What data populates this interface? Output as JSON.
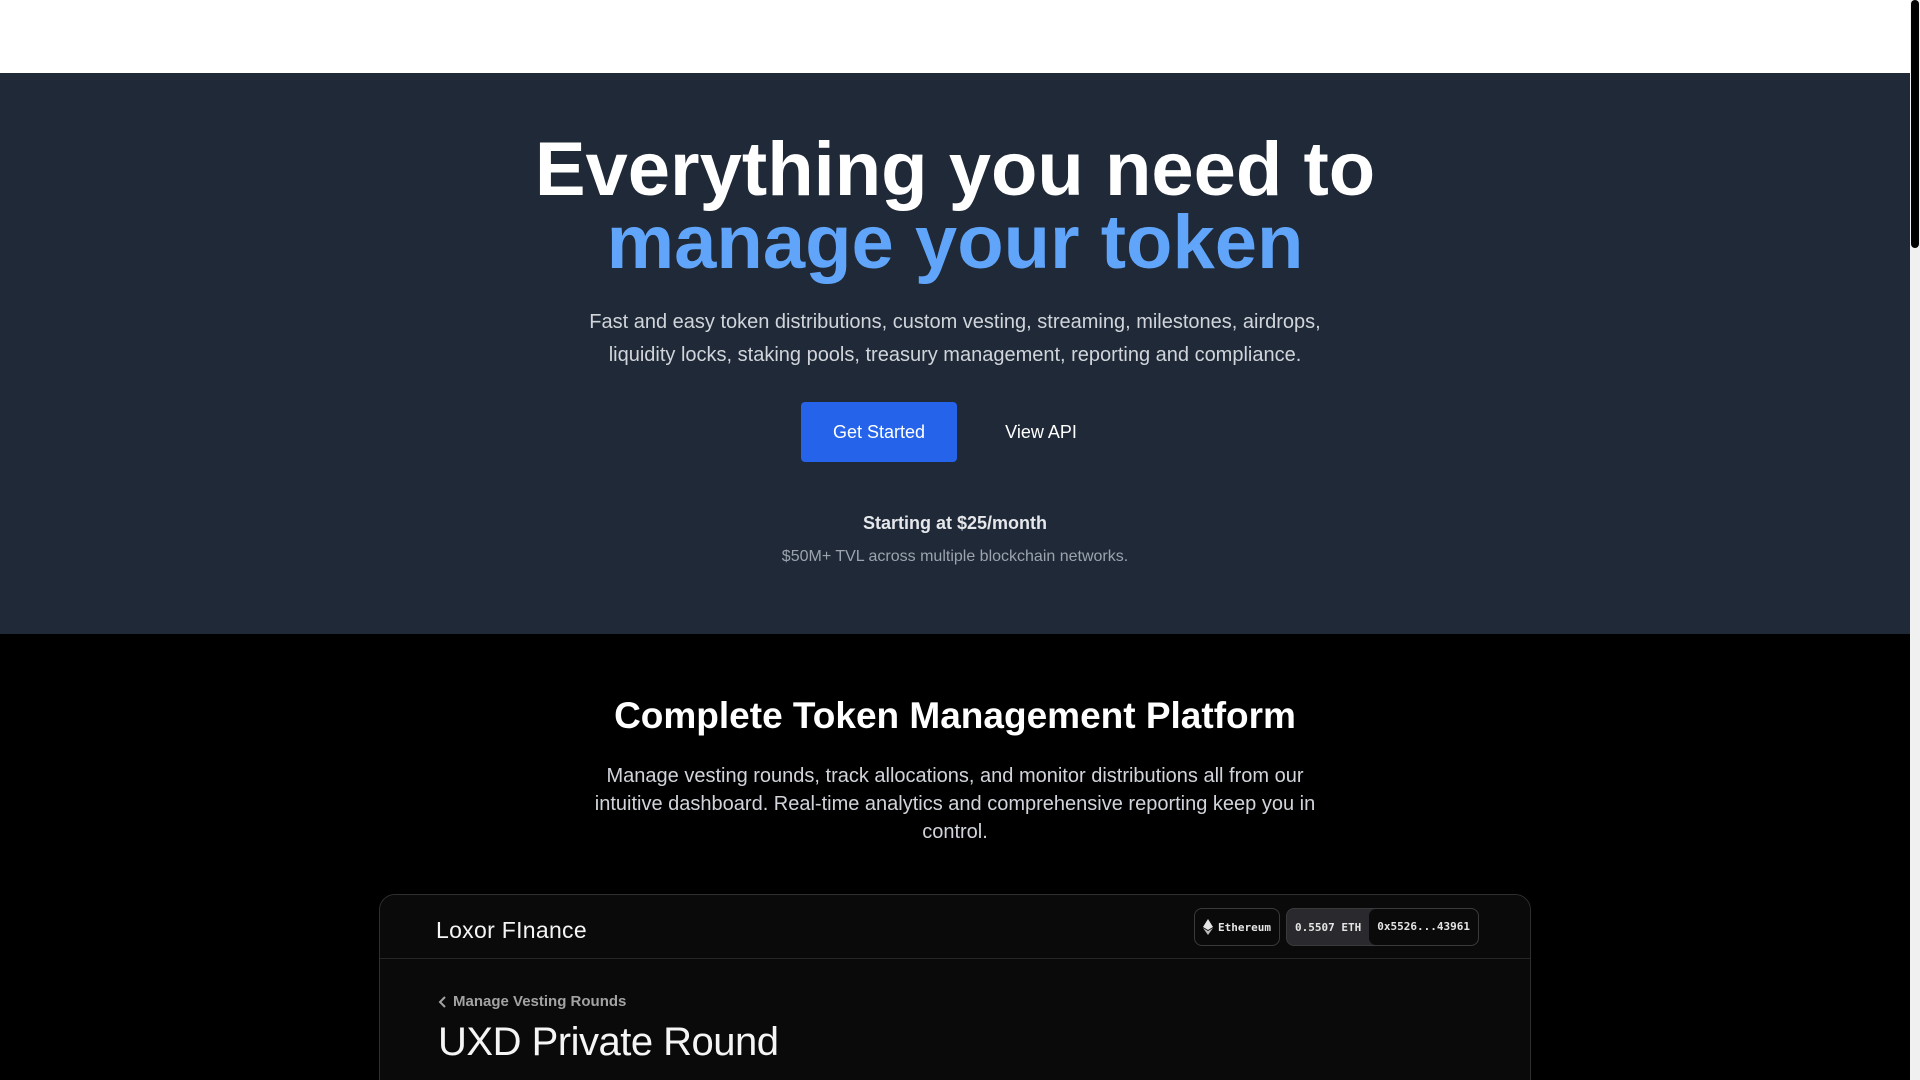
{
  "hero": {
    "title_line1": "Everything you need to",
    "title_line2": "manage your token",
    "subtitle": "Fast and easy token distributions, custom vesting, streaming, milestones, airdrops, liquidity locks, staking pools, treasury management, reporting and compliance.",
    "primary_cta": "Get Started",
    "secondary_cta": "View API",
    "pricing": "Starting at $25/month",
    "tvl": "$50M+ TVL across multiple blockchain networks."
  },
  "platform": {
    "title": "Complete Token Management Platform",
    "description": "Manage vesting rounds, track allocations, and monitor distributions all from our intuitive dashboard. Real-time analytics and comprehensive reporting keep you in control."
  },
  "dashboard": {
    "brand": "Loxor FInance",
    "network": "Ethereum",
    "balance": "0.5507 ETH",
    "address": "0x5526...43961",
    "back_link": "Manage Vesting Rounds",
    "round_title": "UXD Private Round"
  },
  "icons": {
    "network": "ethereum-icon",
    "back": "chevron-left-icon"
  },
  "colors": {
    "hero_bg": "#1f2937",
    "accent": "#60a5fa",
    "primary_button": "#2563eb"
  }
}
